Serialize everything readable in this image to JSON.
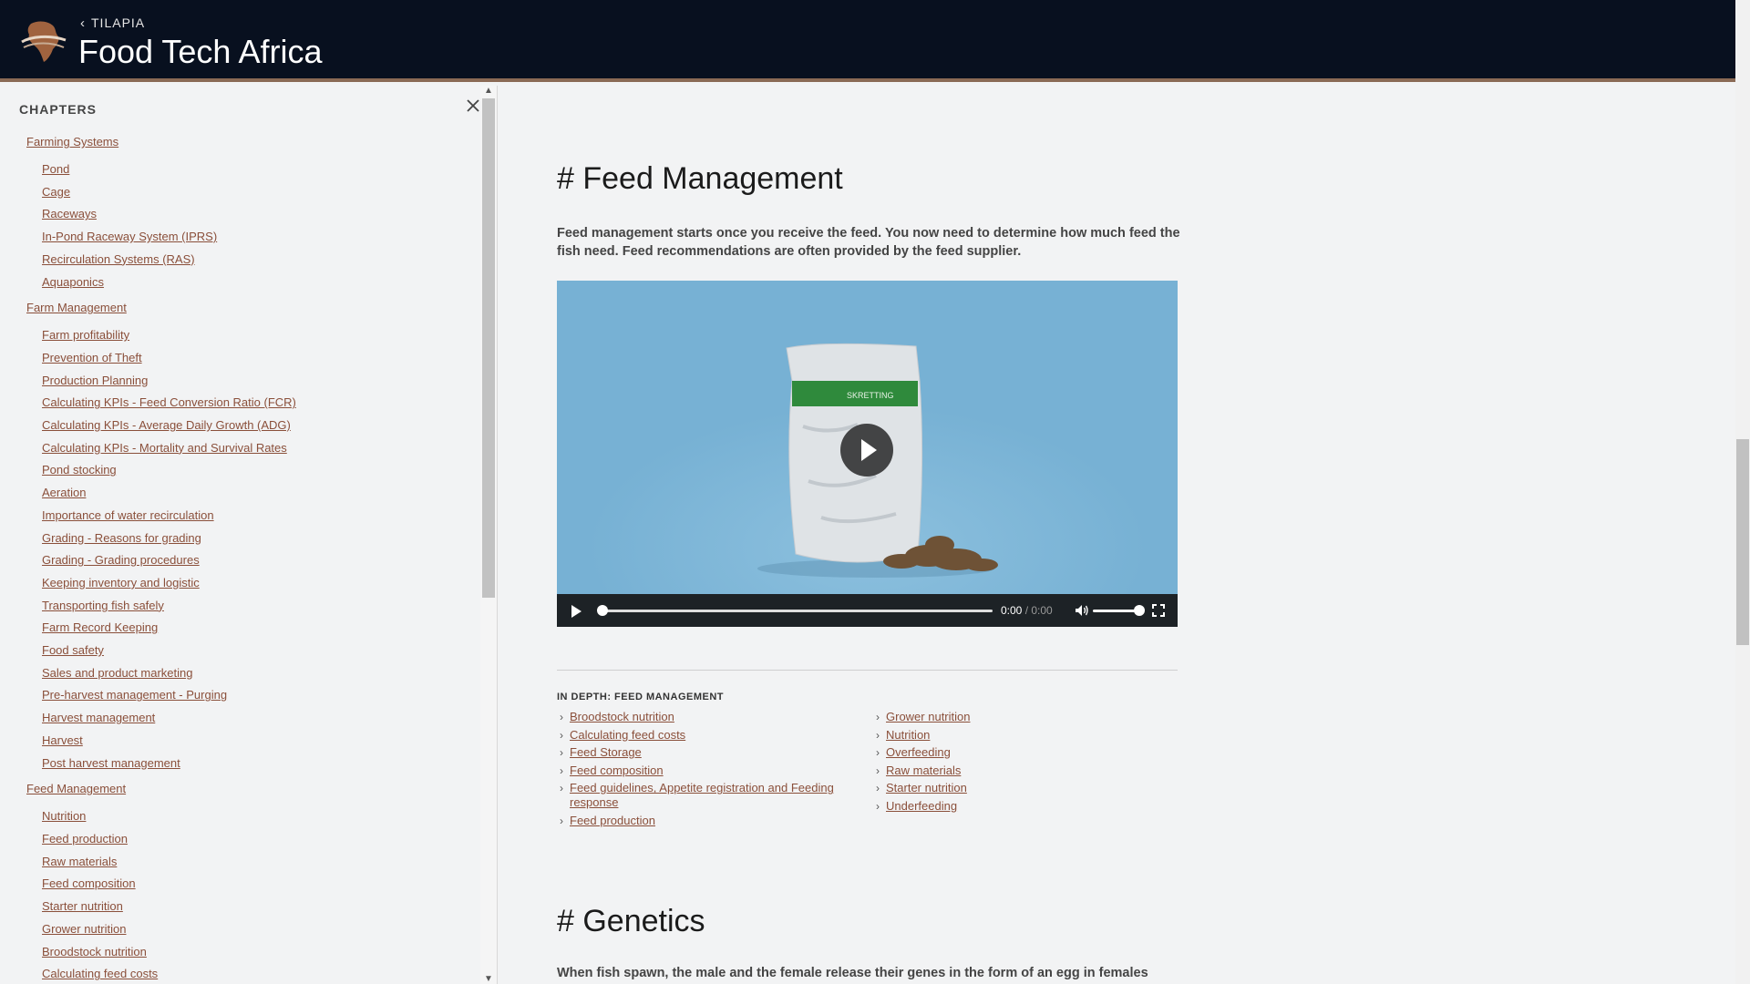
{
  "header": {
    "back_label": "TILAPIA",
    "site_title": "Food Tech Africa"
  },
  "sidebar": {
    "heading": "CHAPTERS",
    "groups": [
      {
        "title": "Farming Systems",
        "items": [
          "Pond",
          "Cage",
          "Raceways",
          "In-Pond Raceway System (IPRS)",
          "Recirculation Systems (RAS)",
          "Aquaponics"
        ]
      },
      {
        "title": "Farm Management",
        "items": [
          "Farm profitability",
          "Prevention of Theft",
          "Production Planning",
          "Calculating KPIs - Feed Conversion Ratio (FCR)",
          "Calculating KPIs - Average Daily Growth (ADG)",
          "Calculating KPIs - Mortality and Survival Rates",
          "Pond stocking",
          "Aeration",
          "Importance of water recirculation",
          "Grading - Reasons for grading",
          "Grading - Grading procedures",
          "Keeping inventory and logistic",
          "Transporting fish safely",
          "Farm Record Keeping",
          "Food safety",
          "Sales and product marketing",
          "Pre-harvest management - Purging",
          "Harvest management",
          "Harvest",
          "Post harvest management"
        ]
      },
      {
        "title": "Feed Management",
        "items": [
          "Nutrition",
          "Feed production",
          "Raw materials",
          "Feed composition",
          "Starter nutrition",
          "Grower nutrition",
          "Broodstock nutrition",
          "Calculating feed costs"
        ]
      }
    ]
  },
  "main": {
    "feed_title": "# Feed Management",
    "feed_intro": "Feed management starts once you receive the feed. You now need to determine how much feed the fish need. Feed recommendations are often provided by the feed supplier.",
    "video": {
      "time_current": "0:00",
      "time_separator": " / ",
      "time_duration": "0:00",
      "progress": 0,
      "volume": 0.9,
      "bag_brand": "SKRETTING"
    },
    "indepth": {
      "heading": "IN DEPTH: FEED MANAGEMENT",
      "left": [
        "Broodstock nutrition",
        "Calculating feed costs",
        "Feed Storage",
        "Feed composition",
        "Feed guidelines, Appetite registration and Feeding response",
        "Feed production"
      ],
      "right": [
        "Grower nutrition",
        "Nutrition",
        "Overfeeding",
        "Raw materials",
        "Starter nutrition",
        "Underfeeding"
      ]
    },
    "genetics_title": "# Genetics",
    "genetics_intro": "When fish spawn, the male and the female release their genes in the form of an egg in females"
  },
  "colors": {
    "header_bg": "#08101f",
    "accent_border": "#8a6a55",
    "link": "#8a4f3a",
    "video_bg": "#77b1d4"
  }
}
